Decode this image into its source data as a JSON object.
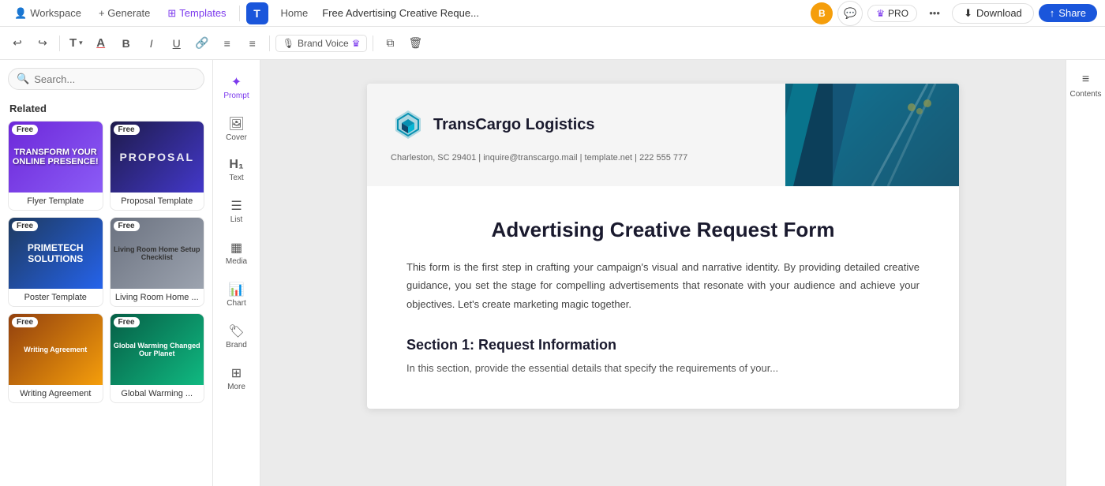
{
  "topnav": {
    "workspace_label": "Workspace",
    "generate_label": "+ Generate",
    "templates_label": "Templates",
    "home_label": "Home",
    "doc_title": "Free Advertising Creative Reque...",
    "user_initials": "B",
    "pro_label": "PRO",
    "download_label": "Download",
    "share_label": "Share"
  },
  "toolbar": {
    "brand_voice_label": "Brand Voice",
    "font_label": "T"
  },
  "sidebar": {
    "search_placeholder": "Search...",
    "section_title": "Related",
    "templates": [
      {
        "name": "Flyer Template",
        "badge": "Free",
        "color": "tpl-purple"
      },
      {
        "name": "Proposal Template",
        "badge": "Free",
        "color": "tpl-dark"
      },
      {
        "name": "Poster Template",
        "badge": "Free",
        "color": "tpl-navy"
      },
      {
        "name": "Living Room Home ...",
        "badge": "Free",
        "color": "tpl-grey"
      },
      {
        "name": "Writing Agreement",
        "badge": "Free",
        "color": "tpl-orange"
      },
      {
        "name": "Global Warming ...",
        "badge": "Free",
        "color": "tpl-green"
      }
    ]
  },
  "tools": [
    {
      "id": "prompt",
      "label": "Prompt",
      "icon": "✦"
    },
    {
      "id": "cover",
      "label": "Cover",
      "icon": "🖼"
    },
    {
      "id": "text",
      "label": "Text",
      "icon": "H₁"
    },
    {
      "id": "list",
      "label": "List",
      "icon": "☰"
    },
    {
      "id": "media",
      "label": "Media",
      "icon": "⬛"
    },
    {
      "id": "chart",
      "label": "Chart",
      "icon": "📊"
    },
    {
      "id": "brand",
      "label": "Brand",
      "icon": "🏷"
    },
    {
      "id": "more",
      "label": "More",
      "icon": "⊞"
    }
  ],
  "document": {
    "company_name": "TransCargo Logistics",
    "company_info": "Charleston, SC 29401 | inquire@transcargo.mail | template.net | 222 555 777",
    "main_title": "Advertising Creative Request Form",
    "intro": "This form is the first step in crafting your campaign's visual and narrative identity. By providing detailed creative guidance, you set the stage for compelling advertisements that resonate with your audience and achieve your objectives. Let's create marketing magic together.",
    "section1_title": "Section 1: Request Information",
    "section1_text": "In this section, provide the essential details that specify the requirements of your..."
  },
  "contents": {
    "label": "Contents"
  }
}
